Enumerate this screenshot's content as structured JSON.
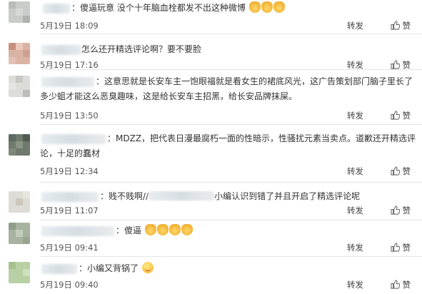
{
  "actions": {
    "repost": "转发",
    "like": "赞"
  },
  "comments": [
    {
      "name_suffix": "：",
      "text": "傻逼玩意  没个十年脑血栓都发不出这种微博",
      "emoji": "face-palm x3",
      "time": "5月19日 18:09"
    },
    {
      "name_suffix": "",
      "text": "怎么还开精选评论啊？要不要脸",
      "time": "5月19日 17:16"
    },
    {
      "name_suffix": "：",
      "text_line1": "这意思就是长安车主一饱眼福就是看女生的裙底风光，这广告策划部门脑子里长了",
      "text_line2": "多少蛆才能这么恶臭趣味，这是给长安车主招黑，给长安品牌抹屎。",
      "time": "5月19日 13:50"
    },
    {
      "name_suffix": "：",
      "text_line1": "MDZZ，把代表日漫最腐朽一面的性暗示，性骚扰元素当卖点。道歉还开精选评",
      "text_line2": "论，十足的蠢材",
      "time": "5月19日 12:34"
    },
    {
      "name_suffix": "：",
      "text_a": "贱不贱啊//",
      "text_b": "小编认识到错了并且开启了精选评论呢",
      "time": "5月19日 11:07"
    },
    {
      "name_suffix": "：",
      "text": "傻逼",
      "emoji": "ok-hand x4",
      "time": "5月19日 09:41"
    },
    {
      "name_suffix": "：",
      "text": "小编又背锅了",
      "emoji": "smirk",
      "time": "5月19日 09:40"
    }
  ],
  "colors": {
    "divider": "#e6e6e6",
    "text": "#333333"
  }
}
